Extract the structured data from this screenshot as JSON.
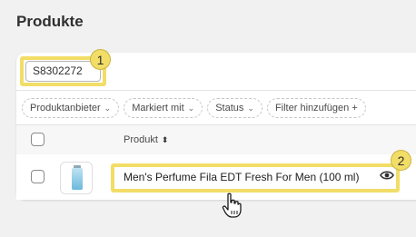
{
  "page": {
    "title": "Produkte"
  },
  "search": {
    "value": "S8302272"
  },
  "filters": [
    {
      "label": "Produktanbieter",
      "has_chevron": true
    },
    {
      "label": "Markiert mit",
      "has_chevron": true
    },
    {
      "label": "Status",
      "has_chevron": true
    },
    {
      "label": "Filter hinzufügen +",
      "has_chevron": false
    }
  ],
  "table": {
    "column_product": "Produkt",
    "rows": [
      {
        "name": "Men's Perfume Fila EDT Fresh For Men (100 ml)",
        "thumbnail": "perfume-bottle"
      }
    ]
  },
  "callouts": {
    "first": "1",
    "second": "2"
  },
  "colors": {
    "highlight": "#f2dd67",
    "background": "#f1f1f1"
  },
  "icons": {
    "sort": "sort-icon",
    "preview": "eye-icon",
    "cursor": "hand-pointer-icon"
  }
}
